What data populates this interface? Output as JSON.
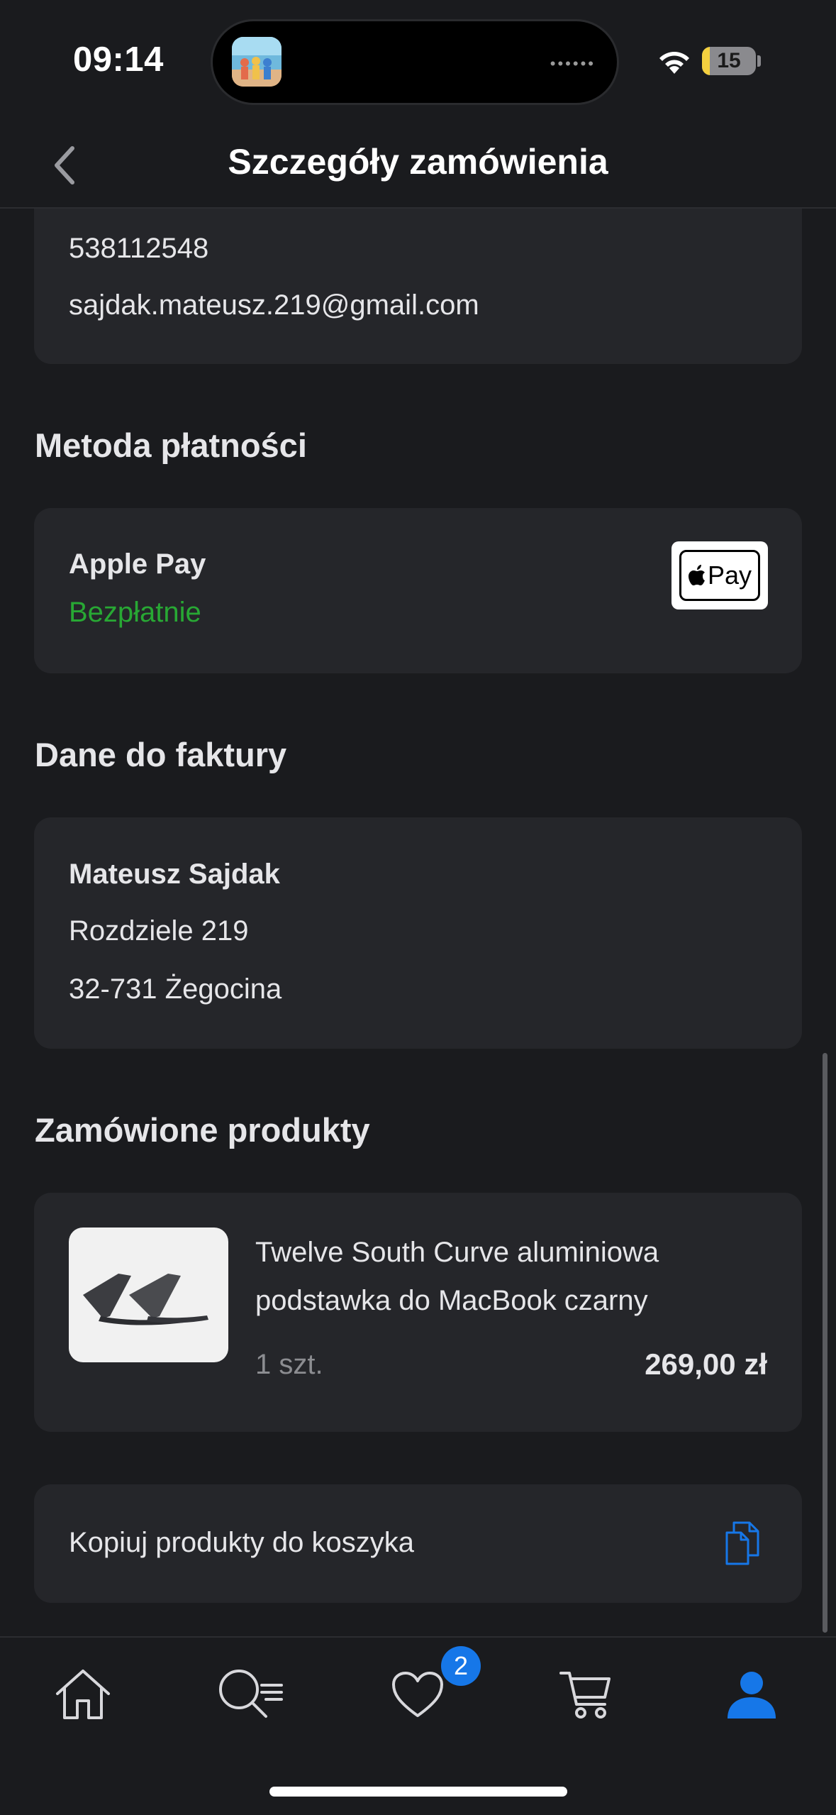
{
  "status_bar": {
    "time": "09:14",
    "battery": "15",
    "battery_level": 0.15
  },
  "nav": {
    "title": "Szczegóły zamówienia"
  },
  "contact": {
    "phone": "538112548",
    "email": "sajdak.mateusz.219@gmail.com"
  },
  "payment": {
    "section_title": "Metoda płatności",
    "method": "Apple Pay",
    "fee": "Bezpłatnie",
    "logo_text": "Pay"
  },
  "invoice": {
    "section_title": "Dane do faktury",
    "name": "Mateusz Sajdak",
    "street": "Rozdziele 219",
    "city": "32-731 Żegocina"
  },
  "products": {
    "section_title": "Zamówione produkty",
    "items": [
      {
        "name": "Twelve South Curve aluminiowa podstawka do MacBook czarny",
        "quantity": "1 szt.",
        "price": "269,00 zł"
      }
    ]
  },
  "actions": {
    "copy_to_cart": "Kopiuj produkty do koszyka"
  },
  "tab_bar": {
    "items": [
      "home-icon",
      "search-list-icon",
      "heart-icon",
      "cart-icon",
      "user-icon"
    ],
    "favorites_badge": "2",
    "active": "user-icon",
    "accent": "#1677e8"
  },
  "colors": {
    "background": "#1a1b1e",
    "card": "#25262a",
    "success": "#28a834",
    "accent": "#1677e8"
  }
}
